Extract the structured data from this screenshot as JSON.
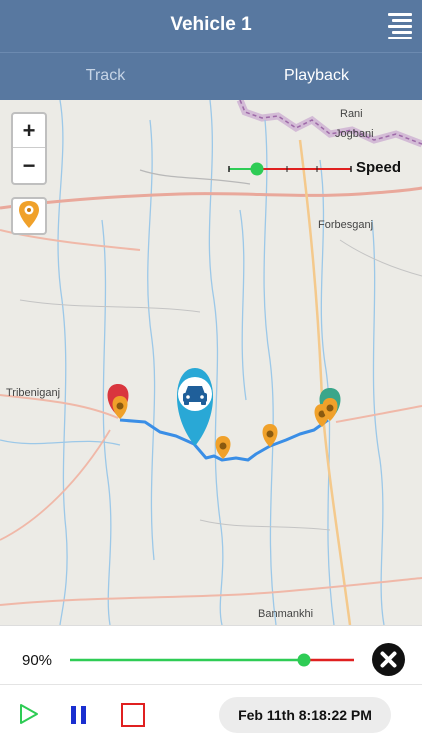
{
  "header": {
    "title": "Vehicle 1",
    "menu_icon": "hamburger-menu-icon"
  },
  "tabs": [
    {
      "label": "Track",
      "active": false
    },
    {
      "label": "Playback",
      "active": true
    }
  ],
  "map": {
    "place_labels": {
      "rani": "Rani",
      "jogbani": "Jogbani",
      "forbesganj": "Forbesganj",
      "tribeniganj": "Tribeniganj",
      "banmankhi": "Banmankhi"
    },
    "zoom_in_label": "+",
    "zoom_out_label": "−",
    "locate_icon": "location-pin-icon",
    "speed_label": "Speed",
    "route_color": "#3a8ee6",
    "start_marker_color": "#d9363e",
    "end_marker_color": "#3aa68a",
    "stop_marker_color": "#f0a12a",
    "vehicle_marker_color": "#29a8d6"
  },
  "playback": {
    "progress_label": "90%",
    "progress_fraction": 0.9,
    "timestamp": "Feb 11th 8:18:22 PM",
    "play_icon": "play-icon",
    "pause_icon": "pause-icon",
    "stop_icon": "stop-icon",
    "close_icon": "close-icon",
    "progress_color": "#2ecc55",
    "remaining_color": "#e02020"
  }
}
